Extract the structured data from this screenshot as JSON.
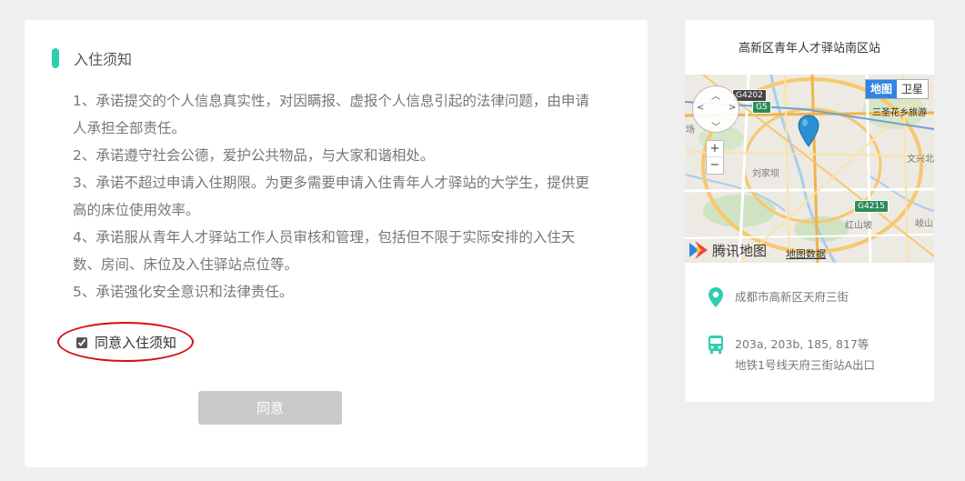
{
  "notice": {
    "title": "入住须知",
    "rules": [
      "1、承诺提交的个人信息真实性，对因瞒报、虚报个人信息引起的法律问题，由申请人承担全部责任。",
      "2、承诺遵守社会公德，爱护公共物品，与大家和谐相处。",
      "3、承诺不超过申请入住期限。为更多需要申请入住青年人才驿站的大学生，提供更高的床位使用效率。",
      "4、承诺服从青年人才驿站工作人员审核和管理，包括但不限于实际安排的入住天数、房间、床位及入住驿站点位等。",
      "5、承诺强化安全意识和法律责任。"
    ],
    "agree_checkbox_label": "同意入住须知",
    "agree_checked": true,
    "agree_button": "同意"
  },
  "station": {
    "name": "高新区青年人才驿站南区站",
    "address": "成都市高新区天府三街",
    "bus_lines": "203a, 203b, 185, 817等",
    "metro": "地铁1号线天府三街站A出口"
  },
  "map": {
    "type_map": "地图",
    "type_satellite": "卫星",
    "zoom_in": "+",
    "zoom_out": "−",
    "logo_text": "腾讯地图",
    "data_link": "地图数据",
    "labels": {
      "g4202": "G4202",
      "g5": "G5",
      "g4215": "G4215",
      "sanshenghua": "三圣花乡旅游",
      "liujiaba": "刘家坝",
      "hongshanpo": "红山坡",
      "wenxingzhen": "文兴北",
      "qishan": "岐山",
      "edge_left": "场"
    }
  },
  "colors": {
    "accent": "#2fcdb0",
    "annotation_red": "#d40f0f",
    "button_disabled": "#c9c9c9",
    "map_type_active": "#2f86e2",
    "pin": "#2b8fd6"
  }
}
